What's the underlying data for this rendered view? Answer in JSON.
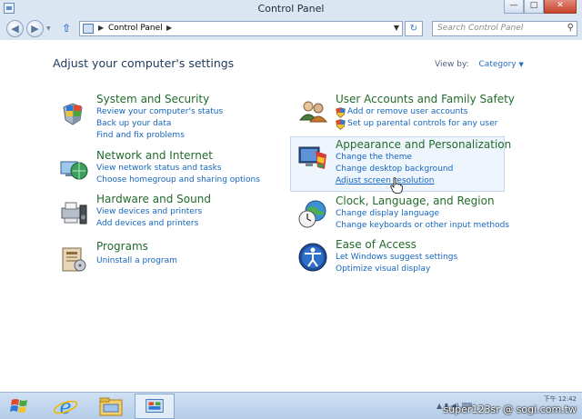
{
  "window": {
    "title": "Control Panel",
    "buttons": {
      "minimize": "—",
      "maximize": "□",
      "close": "✕"
    }
  },
  "address": {
    "back": "◀",
    "forward": "▶",
    "recent": "▼",
    "up": "⇧",
    "separator": "▶",
    "crumb": "Control Panel",
    "dropdown": "▼",
    "refresh": "↻",
    "search_placeholder": "Search Control Panel",
    "search_icon": "⚲"
  },
  "content": {
    "heading": "Adjust your computer's settings",
    "view_by_label": "View by:",
    "view_by_value": "Category",
    "view_by_caret": "▼"
  },
  "categories": [
    {
      "title": "System and Security",
      "icon": "shield-flag-icon",
      "links": [
        "Review your computer's status",
        "Back up your data",
        "Find and fix problems"
      ]
    },
    {
      "title": "Network and Internet",
      "icon": "network-globe-icon",
      "links": [
        "View network status and tasks",
        "Choose homegroup and sharing options"
      ]
    },
    {
      "title": "Hardware and Sound",
      "icon": "printer-speaker-icon",
      "links": [
        "View devices and printers",
        "Add devices and printers"
      ]
    },
    {
      "title": "Programs",
      "icon": "programs-icon",
      "links": [
        "Uninstall a program"
      ]
    },
    {
      "title": "User Accounts and Family Safety",
      "icon": "users-icon",
      "links": [
        "Add or remove user accounts",
        "Set up parental controls for any user"
      ]
    },
    {
      "title": "Appearance and Personalization",
      "icon": "appearance-monitor-icon",
      "links": [
        "Change the theme",
        "Change desktop background",
        "Adjust screen resolution"
      ]
    },
    {
      "title": "Clock, Language, and Region",
      "icon": "clock-globe-icon",
      "links": [
        "Change display language",
        "Change keyboards or other input methods"
      ]
    },
    {
      "title": "Ease of Access",
      "icon": "ease-of-access-icon",
      "links": [
        "Let Windows suggest settings",
        "Optimize visual display"
      ]
    }
  ],
  "taskbar": {
    "clock": "下午 12:42",
    "watermark": "super123sr  @ sogi.com.tw"
  },
  "colors": {
    "category_title": "#216b2b",
    "link": "#1565c0",
    "highlight": "#eef5fd",
    "taskbar": "#c2d6ee"
  }
}
